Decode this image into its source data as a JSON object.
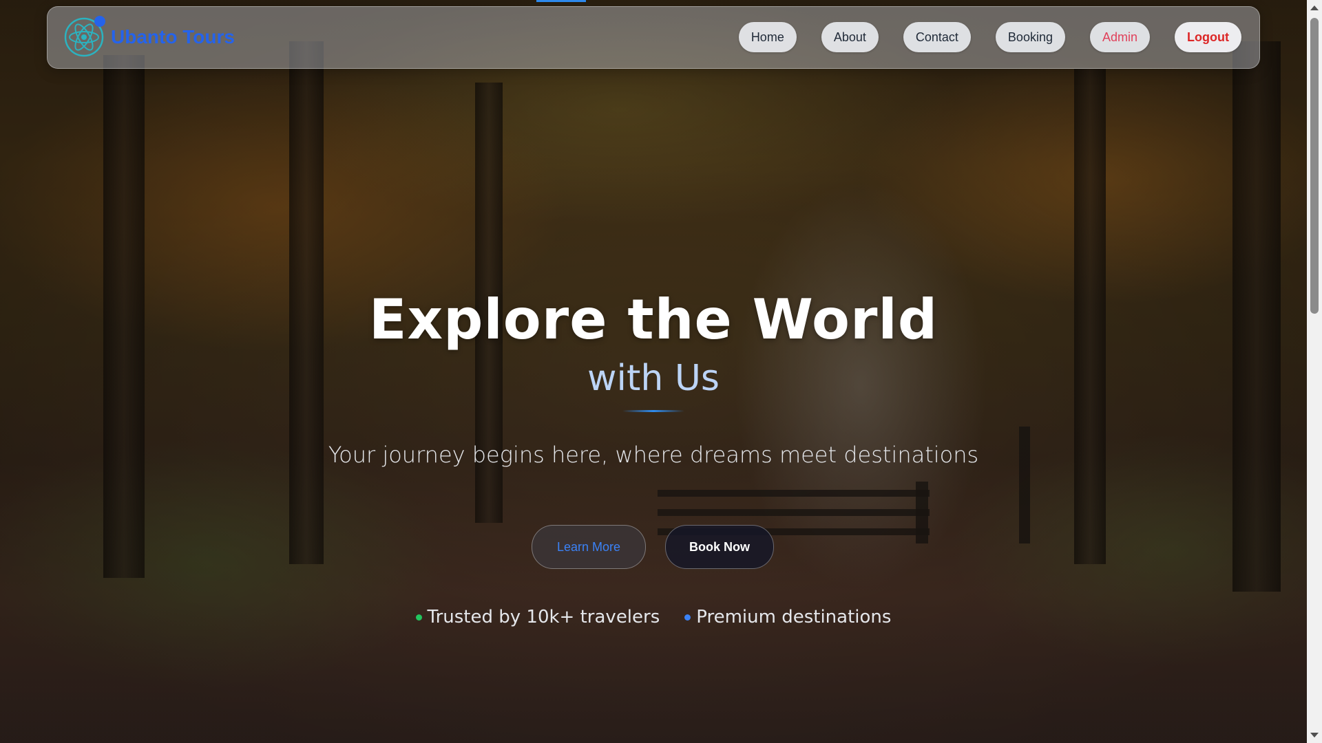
{
  "brand": {
    "name": "Ubanto Tours",
    "logo_icon": "atom-icon",
    "color": "#2563eb"
  },
  "nav": {
    "items": [
      {
        "label": "Home"
      },
      {
        "label": "About"
      },
      {
        "label": "Contact"
      },
      {
        "label": "Booking"
      },
      {
        "label": "Admin"
      },
      {
        "label": "Logout"
      }
    ]
  },
  "hero": {
    "title": "Explore the World",
    "subtitle": "with Us",
    "tagline": "Your journey begins here, where dreams meet destinations",
    "learn_more_label": "Learn More",
    "book_now_label": "Book Now",
    "trust": [
      {
        "text": "Trusted by 10k+ travelers",
        "dot_color": "#22c55e"
      },
      {
        "text": "Premium destinations",
        "dot_color": "#3b82f6"
      }
    ]
  },
  "colors": {
    "accent": "#2f8cf0",
    "admin": "#e0405a",
    "logout": "#dc2626"
  }
}
